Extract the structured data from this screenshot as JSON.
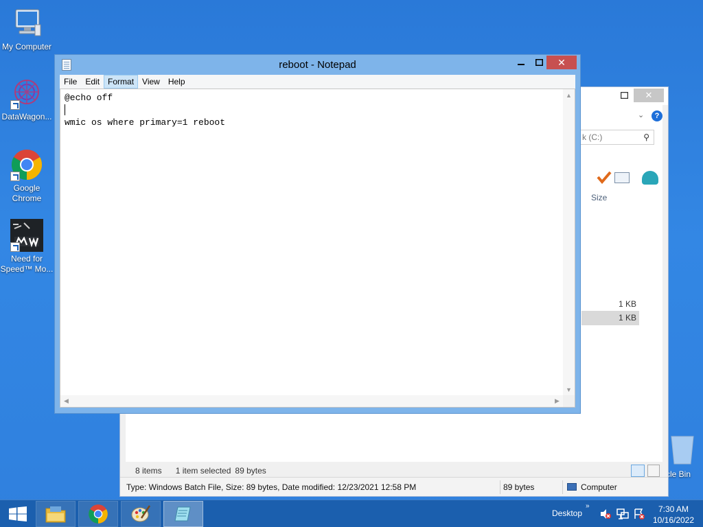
{
  "desktop": {
    "icons": [
      {
        "label": "My Computer"
      },
      {
        "label": "DataWagon..."
      },
      {
        "label": "Google Chrome"
      },
      {
        "label": "Need for Speed™ Mo..."
      }
    ],
    "recycle_bin_label": "cle Bin"
  },
  "explorer": {
    "close_glyph": "✕",
    "search_placeholder": "k (C:)",
    "column_size": "Size",
    "rows": [
      {
        "size": "1 KB"
      },
      {
        "size": "1 KB"
      }
    ],
    "status_items": "8 items",
    "status_selected": "1 item selected",
    "status_bytes": "89 bytes",
    "info_type": "Type: Windows Batch File, Size: 89 bytes, Date modified: 12/23/2021 12:58 PM",
    "info_size": "89 bytes",
    "info_location": "Computer"
  },
  "notepad": {
    "title": "reboot - Notepad",
    "close_glyph": "✕",
    "menu": [
      "File",
      "Edit",
      "Format",
      "View",
      "Help"
    ],
    "active_menu_index": 2,
    "content": "@echo off\n\nwmic os where primary=1 reboot"
  },
  "taskbar": {
    "desktop_label": "Desktop",
    "time": "7:30 AM",
    "date": "10/16/2022"
  },
  "colors": {
    "desktop_bg": "#2f80de",
    "taskbar": "#1b5fae",
    "window_frame": "#7eb4ea",
    "close_button": "#c75050"
  }
}
